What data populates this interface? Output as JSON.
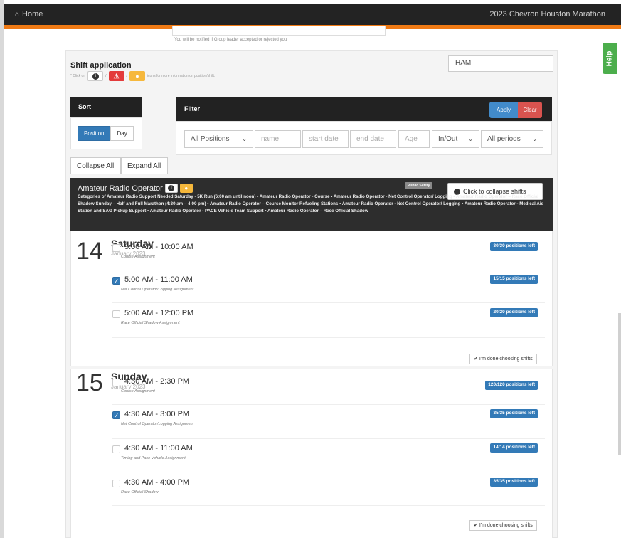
{
  "topbar": {
    "home_label": "Home",
    "event_title": "2023 Chevron Houston Marathon"
  },
  "help_label": "Help",
  "notify_text": "You will be notified if Group leader accepted or rejected you",
  "shift_application": {
    "title": "Shift application",
    "legend_prefix": "* Click on",
    "legend_suffix": "icons for more information on position/shift.",
    "sep1": "/",
    "sep2": "/",
    "group_input_value": "HAM"
  },
  "sort": {
    "title": "Sort",
    "options": [
      "Position",
      "Day"
    ],
    "active": "Position"
  },
  "filter": {
    "title": "Filter",
    "apply_label": "Apply",
    "clear_label": "Clear",
    "positions_value": "All Positions",
    "name_placeholder": "name",
    "start_placeholder": "start date",
    "end_placeholder": "end date",
    "age_placeholder": "Age",
    "inout_value": "In/Out",
    "periods_value": "All periods"
  },
  "collapse_all_label": "Collapse All",
  "expand_all_label": "Expand All",
  "position": {
    "name": "Amateur Radio Operator",
    "badge": "Public Safety",
    "collapse_label": "Click to collapse shifts",
    "description": "Categories of Amateur Radio Support Needed Saturday - 5K Run (6:00 am until noon) • Amateur Radio Operator - Course • Amateur Radio Operator - Net Control Operator/ Logging • Amateur Radio Operator – Race Official Shadow Sunday – Half and Full Marathon (4:30 am – 4:00 pm) • Amateur Radio Operator – Course Monitor Refueling Stations • Amateur Radio Operator - Net Control Operator/ Logging • Amateur Radio Operator - Medical Aid Station and SAG Pickup Support • Amateur Radio Operator - PACE Vehicle Team Support • Amateur Radio Operator – Race Official Shadow"
  },
  "days": [
    {
      "num": "14",
      "name": "Saturday",
      "month": "January 2023",
      "done_label": "I'm done choosing shifts",
      "shifts": [
        {
          "time": "5:00 AM - 10:00 AM",
          "sub": "Course Assignment",
          "slots": "30/30 positions left",
          "checked": false
        },
        {
          "time": "5:00 AM - 11:00 AM",
          "sub": "Net Control Operator/Logging Assignment",
          "slots": "15/15 positions left",
          "checked": true
        },
        {
          "time": "5:00 AM - 12:00 PM",
          "sub": "Race Official Shadow Assignment",
          "slots": "20/20 positions left",
          "checked": false
        }
      ]
    },
    {
      "num": "15",
      "name": "Sunday",
      "month": "January 2023",
      "done_label": "I'm done choosing shifts",
      "shifts": [
        {
          "time": "4:30 AM - 2:30 PM",
          "sub": "Course Assignment",
          "slots": "120/120 positions left",
          "checked": false
        },
        {
          "time": "4:30 AM - 3:00 PM",
          "sub": "Net Control Operator/Logging Assignment",
          "slots": "35/35 positions left",
          "checked": true
        },
        {
          "time": "4:30 AM - 11:00 AM",
          "sub": "Timing and Pace Vehicle Assignment",
          "slots": "14/14 positions left",
          "checked": false
        },
        {
          "time": "4:30 AM - 4:00 PM",
          "sub": "Race Official Shadow",
          "slots": "35/35 positions left",
          "checked": false
        }
      ]
    }
  ]
}
